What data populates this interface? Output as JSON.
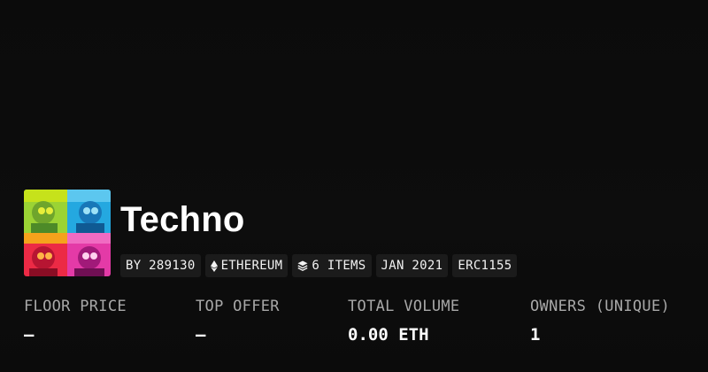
{
  "collection": {
    "title": "Techno",
    "creator": "BY 289130",
    "chain": "ETHEREUM",
    "items": "6 ITEMS",
    "date": "JAN 2021",
    "standard": "ERC1155"
  },
  "stats": [
    {
      "label": "FLOOR PRICE",
      "value": "—"
    },
    {
      "label": "TOP OFFER",
      "value": "—"
    },
    {
      "label": "TOTAL VOLUME",
      "value": "0.00 ETH"
    },
    {
      "label": "OWNERS (UNIQUE)",
      "value": "1"
    }
  ],
  "icons": {
    "chain": "ethereum-icon",
    "items": "layers-icon"
  },
  "colors": {
    "background": "#0b0b0b",
    "chip": "#1b1b1b",
    "label": "#a8a8a8",
    "text": "#ffffff"
  }
}
